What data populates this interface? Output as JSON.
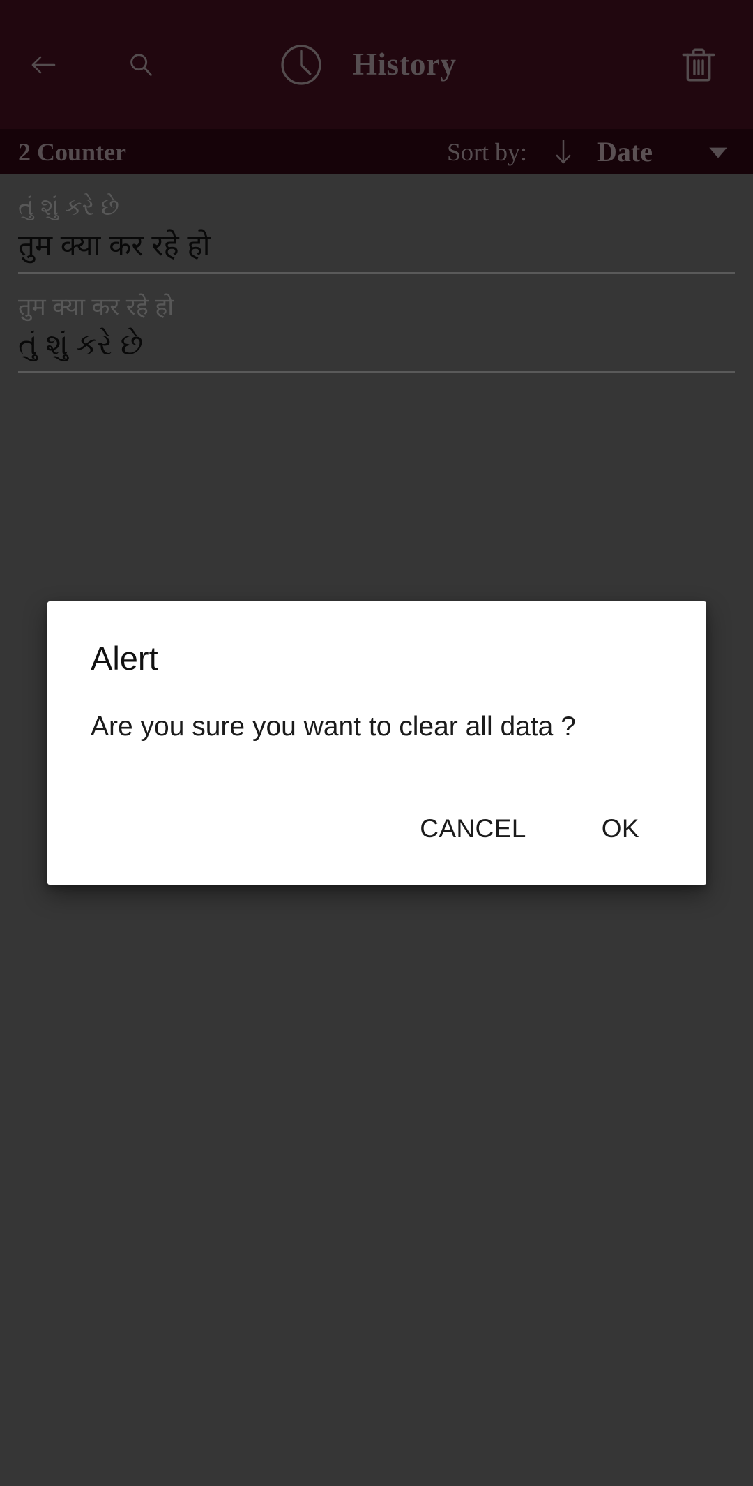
{
  "app_bar": {
    "title": "History",
    "back_icon": "back-arrow-icon",
    "search_icon": "search-icon",
    "clock_icon": "clock-icon",
    "delete_icon": "trash-icon",
    "background_color": "#3d0d1c",
    "foreground_color": "#a09196"
  },
  "sort_bar": {
    "counter_label": "2 Counter",
    "sort_by_label": "Sort by:",
    "sort_direction_icon": "arrow-down-icon",
    "sort_value": "Date",
    "dropdown_icon": "caret-down-icon",
    "background_color": "#2a0612",
    "foreground_color": "#9d8d93"
  },
  "history": {
    "items": [
      {
        "source_text": "તું શું કરે છે",
        "target_text": "तुम क्या कर रहे हो"
      },
      {
        "source_text": "तुम क्या कर रहे हो",
        "target_text": "તું શું કરે છે"
      }
    ]
  },
  "alert_dialog": {
    "title": "Alert",
    "message": "Are you sure you want to clear all data ?",
    "cancel_label": "CANCEL",
    "ok_label": "OK",
    "background_color": "#ffffff",
    "text_color": "#111111"
  },
  "scrim": {
    "color": "#646464"
  }
}
